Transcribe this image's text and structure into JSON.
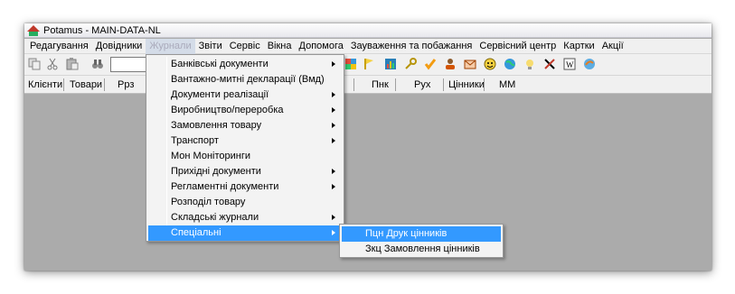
{
  "window": {
    "title": "Potamus - MAIN-DATA-NL"
  },
  "menubar": {
    "items": [
      "Редагування",
      "Довідники",
      "Журнали",
      "Звіти",
      "Сервіс",
      "Вікна",
      "Допомога",
      "Зауваження та побажання",
      "Сервісний центр",
      "Картки",
      "Акції"
    ]
  },
  "toolbar2": {
    "buttons": [
      "Клієнти",
      "Товари",
      "Ррз",
      "Пнк",
      "Рух",
      "Цінники",
      "ММ"
    ]
  },
  "dropdown": {
    "items": [
      {
        "label": "Банківські документи",
        "submenu": true
      },
      {
        "label": "Вантажно-митні декларації (Вмд)",
        "submenu": false
      },
      {
        "label": "Документи реалізації",
        "submenu": true
      },
      {
        "label": "Виробництво/переробка",
        "submenu": true
      },
      {
        "label": "Замовлення товару",
        "submenu": true
      },
      {
        "label": "Транспорт",
        "submenu": true
      },
      {
        "label": "Мон Моніторинги",
        "submenu": false
      },
      {
        "label": "Прихідні документи",
        "submenu": true
      },
      {
        "label": "Регламентні документи",
        "submenu": true
      },
      {
        "label": "Розподіл товару",
        "submenu": false
      },
      {
        "label": "Складські журнали",
        "submenu": true
      },
      {
        "label": "Спеціальні",
        "submenu": true
      }
    ]
  },
  "submenu": {
    "items": [
      "Пцн Друк цінників",
      "Зкц Замовлення цінників"
    ]
  },
  "colors": {
    "highlight": "#3399ff",
    "workspace": "#ababab"
  }
}
